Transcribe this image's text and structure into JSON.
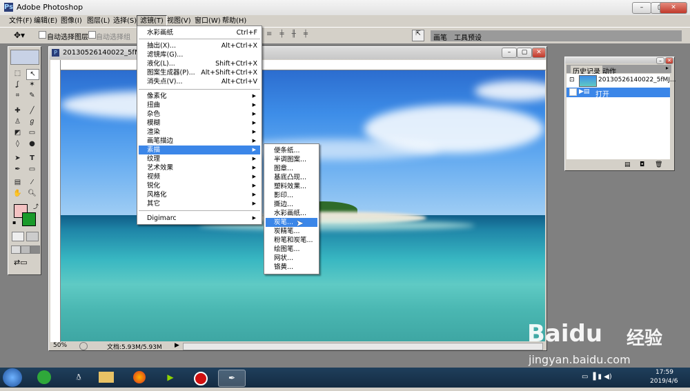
{
  "window": {
    "title": "Adobe Photoshop"
  },
  "menubar": [
    "文件(F)",
    "编辑(E)",
    "图像(I)",
    "图层(L)",
    "选择(S)",
    "滤镜(T)",
    "视图(V)",
    "窗口(W)",
    "帮助(H)"
  ],
  "optionsbar": {
    "auto_select_layer": "自动选择图层",
    "auto_select_group": "自动选择组",
    "palette_tabs": [
      "画笔",
      "工具预设"
    ]
  },
  "document": {
    "title": "20130526140022_5fMJe.j",
    "zoom": "50%",
    "doc_size": "文档:5.93M/5.93M"
  },
  "history_panel": {
    "tabs": [
      "历史记录",
      "动作"
    ],
    "snapshot_name": "20130526140022_5fMJ...",
    "items": [
      "打开"
    ]
  },
  "filter_menu": {
    "items": [
      {
        "label": "水彩画纸",
        "shortcut": "Ctrl+F"
      },
      {
        "label": "抽出(X)...",
        "shortcut": "Alt+Ctrl+X"
      },
      {
        "label": "滤镜库(G)...",
        "shortcut": ""
      },
      {
        "label": "液化(L)...",
        "shortcut": "Shift+Ctrl+X"
      },
      {
        "label": "图案生成器(P)...",
        "shortcut": "Alt+Shift+Ctrl+X"
      },
      {
        "label": "消失点(V)...",
        "shortcut": "Alt+Ctrl+V"
      },
      {
        "label": "像素化",
        "shortcut": ""
      },
      {
        "label": "扭曲",
        "shortcut": ""
      },
      {
        "label": "杂色",
        "shortcut": ""
      },
      {
        "label": "模糊",
        "shortcut": ""
      },
      {
        "label": "渲染",
        "shortcut": ""
      },
      {
        "label": "画笔描边",
        "shortcut": ""
      },
      {
        "label": "素描",
        "shortcut": ""
      },
      {
        "label": "纹理",
        "shortcut": ""
      },
      {
        "label": "艺术效果",
        "shortcut": ""
      },
      {
        "label": "视频",
        "shortcut": ""
      },
      {
        "label": "锐化",
        "shortcut": ""
      },
      {
        "label": "风格化",
        "shortcut": ""
      },
      {
        "label": "其它",
        "shortcut": ""
      },
      {
        "label": "Digimarc",
        "shortcut": ""
      }
    ]
  },
  "sketch_submenu": {
    "items": [
      "便条纸...",
      "半调图案...",
      "图章...",
      "基底凸现...",
      "塑料效果...",
      "影印...",
      "撕边...",
      "水彩画纸...",
      "炭笔...",
      "炭精笔...",
      "粉笔和炭笔...",
      "绘图笔...",
      "网状...",
      "铬黄..."
    ],
    "selected": "炭笔..."
  },
  "taskbar": {
    "time": "17:59",
    "date": "2019/4/6"
  },
  "watermark": {
    "brand": "Baidu",
    "cn": "经验",
    "url": "jingyan.baidu.com"
  },
  "colors": {
    "menu_highlight": "#3b86e8",
    "taskbar": "#1f3f5c",
    "fg_color": "#f4c2c2",
    "bg_color": "#1a9a2a"
  }
}
